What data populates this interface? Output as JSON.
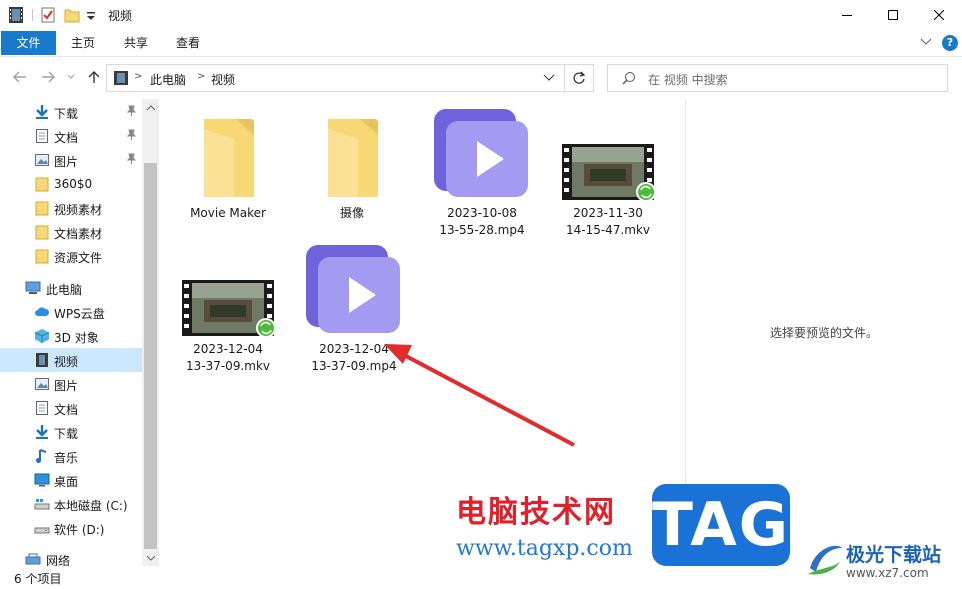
{
  "window": {
    "title": "视频",
    "minimize_glyph": "─",
    "maximize_glyph": "☐",
    "close_glyph": "✕"
  },
  "ribbon": {
    "tabs": [
      {
        "label": "文件"
      },
      {
        "label": "主页"
      },
      {
        "label": "共享"
      },
      {
        "label": "查看"
      }
    ],
    "help": "?"
  },
  "address": {
    "segments": [
      "此电脑",
      "视频"
    ],
    "search_placeholder": "在 视频 中搜索"
  },
  "sidebar": {
    "items": [
      {
        "label": "下载",
        "icon": "download-icon",
        "pinned": true
      },
      {
        "label": "文档",
        "icon": "document-icon",
        "pinned": true
      },
      {
        "label": "图片",
        "icon": "picture-icon",
        "pinned": true
      },
      {
        "label": "360$0",
        "icon": "folder-icon"
      },
      {
        "label": "视频素材",
        "icon": "folder-icon"
      },
      {
        "label": "文档素材",
        "icon": "folder-icon"
      },
      {
        "label": "资源文件",
        "icon": "folder-icon"
      },
      {
        "label": "此电脑",
        "icon": "computer-icon"
      },
      {
        "label": "WPS云盘",
        "icon": "cloud-icon"
      },
      {
        "label": "3D 对象",
        "icon": "cube-icon"
      },
      {
        "label": "视频",
        "icon": "video-icon",
        "selected": true
      },
      {
        "label": "图片",
        "icon": "picture-icon"
      },
      {
        "label": "文档",
        "icon": "document-icon"
      },
      {
        "label": "下载",
        "icon": "download-icon"
      },
      {
        "label": "音乐",
        "icon": "music-icon"
      },
      {
        "label": "桌面",
        "icon": "desktop-icon"
      },
      {
        "label": "本地磁盘 (C:)",
        "icon": "drive-c-icon"
      },
      {
        "label": "软件 (D:)",
        "icon": "drive-d-icon"
      },
      {
        "label": "网络",
        "icon": "network-icon"
      }
    ]
  },
  "files": [
    {
      "name_line1": "Movie Maker",
      "name_line2": "",
      "type": "folder"
    },
    {
      "name_line1": "摄像",
      "name_line2": "",
      "type": "folder"
    },
    {
      "name_line1": "2023-10-08",
      "name_line2": "13-55-28.mp4",
      "type": "video-file"
    },
    {
      "name_line1": "2023-11-30",
      "name_line2": "14-15-47.mkv",
      "type": "video-thumbnail"
    },
    {
      "name_line1": "2023-12-04",
      "name_line2": "13-37-09.mkv",
      "type": "video-thumbnail"
    },
    {
      "name_line1": "2023-12-04",
      "name_line2": "13-37-09.mp4",
      "type": "video-file"
    }
  ],
  "preview": {
    "message": "选择要预览的文件。"
  },
  "status": {
    "item_count": "6 个项目"
  },
  "watermark": {
    "site_cn": "电脑技术网",
    "site_url": "www.tagxp.com",
    "tag": "TAG",
    "brand_cn": "极光下载站",
    "brand_url": "www.xz7.com"
  },
  "colors": {
    "accent": "#1979ca",
    "selected": "#cce8ff",
    "folder": "#f8d775",
    "video_purple": "#8b7ff0",
    "arrow_red": "#e32b2b"
  }
}
